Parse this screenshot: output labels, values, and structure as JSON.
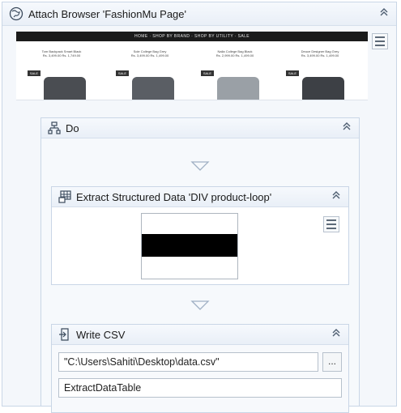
{
  "attach": {
    "title": "Attach Browser 'FashionMu Page'",
    "collapse_icon": "double-chevron-up-icon",
    "screenshot": {
      "nav_text": "HOME · SHOP BY BRAND · SHOP BY UTILITY · SALE",
      "products": [
        {
          "name": "Tom Backpack Smart Black",
          "price": "Rs. 3,499.00  Rs. 1,749.00",
          "badge": "SALE",
          "color": "#4a4d52"
        },
        {
          "name": "Sole College Bag Grey",
          "price": "Rs. 3,499.00  Rs. 1,499.00",
          "badge": "SALE",
          "color": "#5a5e64"
        },
        {
          "name": "Nalla College Bag Black",
          "price": "Rs. 2,999.00  Rs. 1,499.00",
          "badge": "SALE",
          "color": "#9aa0a6"
        },
        {
          "name": "Deuce Designer Bag Grey",
          "price": "Rs. 3,499.00  Rs. 1,499.00",
          "badge": "SALE",
          "color": "#3d4045"
        }
      ]
    }
  },
  "do": {
    "title": "Do"
  },
  "extract": {
    "title": "Extract Structured Data 'DIV  product-loop'"
  },
  "write_csv": {
    "title": "Write CSV",
    "file_path": "\"C:\\Users\\Sahiti\\Desktop\\data.csv\"",
    "browse_label": "...",
    "data_table": "ExtractDataTable"
  }
}
